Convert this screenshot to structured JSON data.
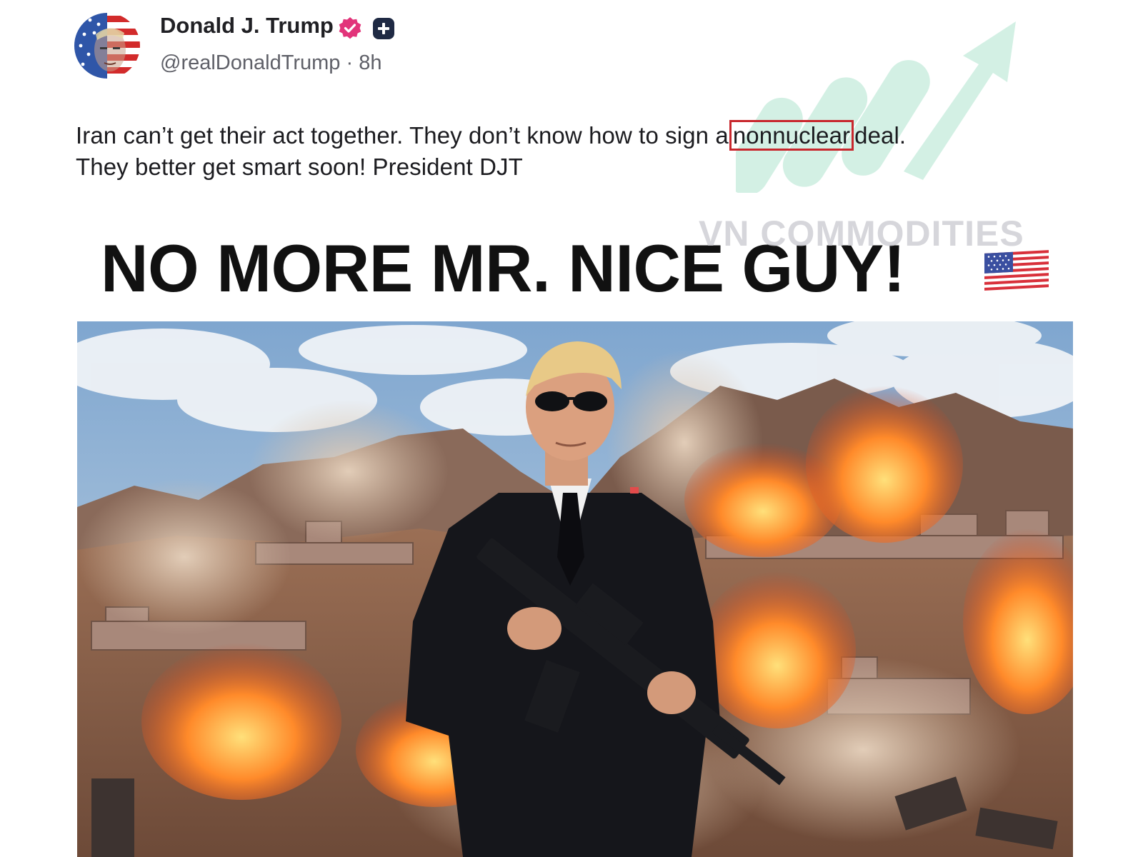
{
  "post": {
    "author": {
      "display_name": "Donald J. Trump",
      "handle": "@realDonaldTrump",
      "separator": "·",
      "time_ago": "8h",
      "verified_badge_icon": "verified-check-icon",
      "plus_badge_icon": "plus-square-icon"
    },
    "text": {
      "before_highlight": "Iran can’t get their act together. They don’t know how to sign a",
      "highlight": "nonnuclear",
      "after_highlight": "deal.",
      "line2": "They better get smart soon! President DJT"
    },
    "image": {
      "headline": "NO MORE MR. NICE GUY!",
      "flag_icon": "us-flag-icon"
    }
  },
  "watermark": {
    "text": "VN COMMODITIES",
    "logo_icon": "rising-arrow-logo-icon"
  },
  "colors": {
    "verified": "#e2347a",
    "highlight_border": "#c8272d",
    "watermark_green": "#3bbf88",
    "text": "#1c1c20",
    "secondary_text": "#5f6068"
  }
}
